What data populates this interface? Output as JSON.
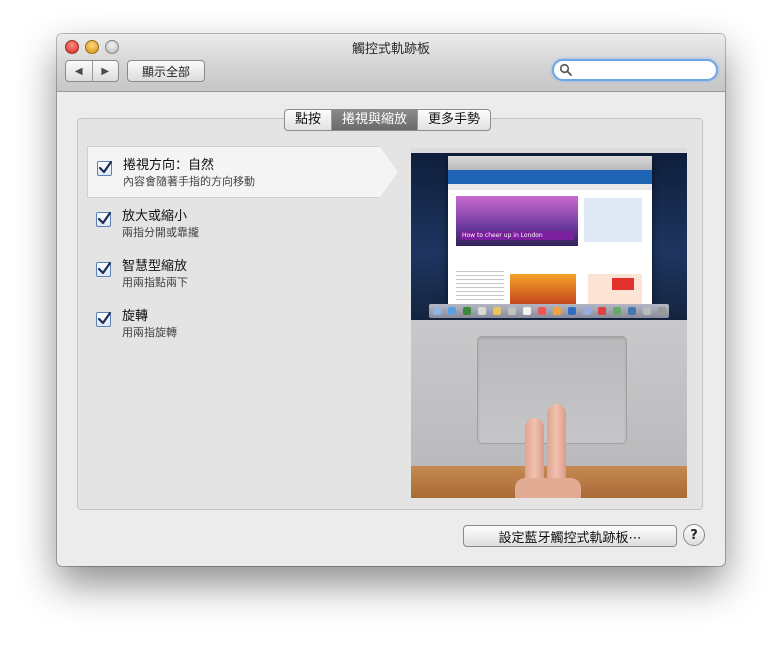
{
  "window": {
    "title": "觸控式軌跡板",
    "nav_back": "◀",
    "nav_forward": "▶",
    "show_all": "顯示全部",
    "search_placeholder": ""
  },
  "tabs": [
    {
      "label": "點按",
      "active": false
    },
    {
      "label": "捲視與縮放",
      "active": true
    },
    {
      "label": "更多手勢",
      "active": false
    }
  ],
  "options": [
    {
      "title": "捲視方向：自然",
      "subtitle": "內容會隨著手指的方向移動",
      "checked": true,
      "selected": true
    },
    {
      "title": "放大或縮小",
      "subtitle": "兩指分開或靠攏",
      "checked": true,
      "selected": false
    },
    {
      "title": "智慧型縮放",
      "subtitle": "用兩指點兩下",
      "checked": true,
      "selected": false
    },
    {
      "title": "旋轉",
      "subtitle": "用兩指旋轉",
      "checked": true,
      "selected": false
    }
  ],
  "preview": {
    "hero_caption": "How to cheer up in London"
  },
  "footer": {
    "bluetooth_button": "設定藍牙觸控式軌跡板⋯",
    "help": "?"
  },
  "colors": {
    "accent": "#1f63b5",
    "checkbox_border": "#5b7fb8",
    "search_focus": "#6ea6e8"
  }
}
